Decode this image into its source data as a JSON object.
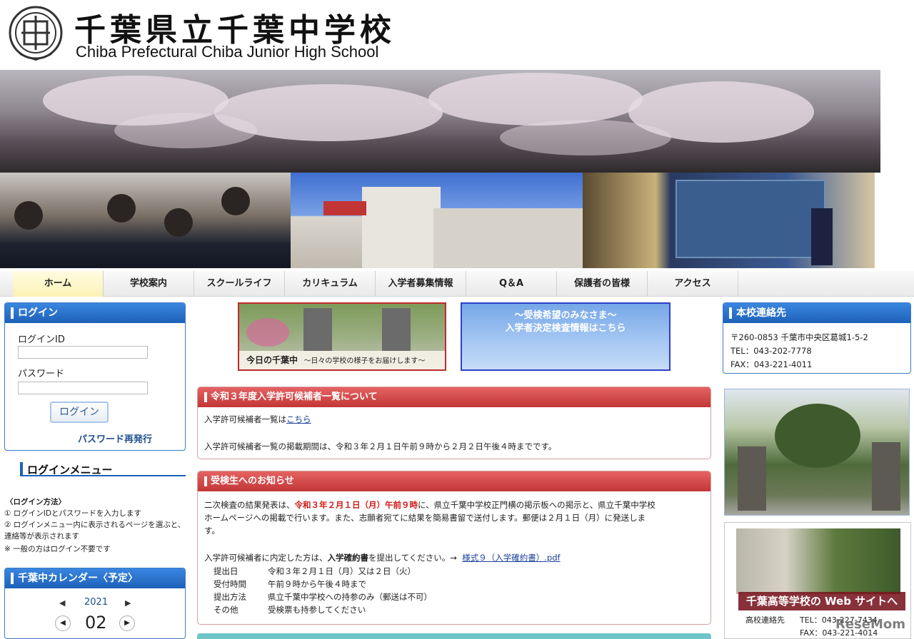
{
  "header": {
    "title_jp": "千葉県立千葉中学校",
    "title_en": "Chiba Prefectural Chiba Junior High School"
  },
  "nav": {
    "items": [
      "ホーム",
      "学校案内",
      "スクールライフ",
      "カリキュラム",
      "入学者募集情報",
      "Q＆A",
      "保護者の皆様",
      "アクセス"
    ],
    "active_index": 0
  },
  "login": {
    "heading": "ログイン",
    "id_label": "ログインID",
    "password_label": "パスワード",
    "button": "ログイン",
    "reissue_link": "パスワード再発行"
  },
  "login_menu": {
    "heading": "ログインメニュー",
    "method_title": "〈ログイン方法〉",
    "step1": "① ログインIDとパスワードを入力します",
    "step2": "② ログインメニュー内に表示されるページを選ぶと、",
    "step2b": "連絡等が表示されます",
    "note": "※ 一般の方はログイン不要です"
  },
  "calendar": {
    "heading": "千葉中カレンダー〈予定〉",
    "year": "2021",
    "month": "02",
    "prev_symbol": "◀",
    "next_symbol": "▶"
  },
  "banners": {
    "today_title": "今日の千葉中",
    "today_sub": "～日々の学校の様子をお届けします～",
    "exam_line1": "～受検希望のみなさま～",
    "exam_line2": "入学者決定検査情報はこちら"
  },
  "notice1": {
    "heading": "令和３年度入学許可候補者一覧について",
    "line1_prefix": "入学許可候補者一覧は",
    "line1_link": "こちら",
    "line2": "入学許可候補者一覧の掲載期間は、令和３年２月１日午前９時から２月２日午後４時までです。"
  },
  "notice2": {
    "heading": "受検生へのお知らせ",
    "p1_a": "二次検査の結果発表は、",
    "p1_red": "令和３年２月１日（月）午前９時",
    "p1_b": "に、県立千葉中学校正門横の掲示板への掲示と、県立千葉中学校",
    "p1_c": "ホームページへの掲載で行います。また、志願者宛てに結果を簡易書留で送付します。郵便は２月１日（月）に発送しま",
    "p1_d": "す。",
    "p2_a": "入学許可候補者に内定した方は、",
    "p2_bold": "入学確約書",
    "p2_b": "を提出してください。→",
    "p2_link": "様式９（入学確約書）.pdf",
    "rows": [
      {
        "k": "提出日",
        "v": "令和３年２月１日（月）又は２日（火）"
      },
      {
        "k": "受付時間",
        "v": "午前９時から午後４時まで"
      },
      {
        "k": "提出方法",
        "v": "県立千葉中学校への持参のみ（郵送は不可）"
      },
      {
        "k": "その他",
        "v": "受検票も持参してください"
      }
    ]
  },
  "contact": {
    "heading": "本校連絡先",
    "address": "〒260-0853 千葉市中央区葛城1-5-2",
    "tel": "TEL：043-202-7778",
    "fax": "FAX：043-221-4011"
  },
  "highschool": {
    "caption": "千葉高等学校の Web サイトへ",
    "label": "高校連絡先",
    "tel": "TEL：043-227-7434",
    "fax": "FAX：043-221-4014"
  },
  "watermark": "ReseMom"
}
